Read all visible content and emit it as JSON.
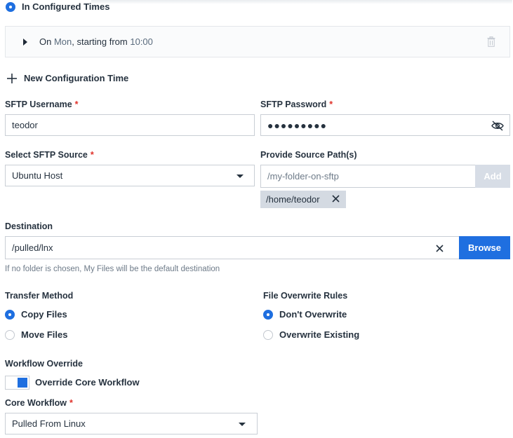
{
  "schedule": {
    "option_label": "In Configured Times",
    "entry": {
      "prefix": "On",
      "day": "Mon",
      "middle": ", starting from",
      "time": "10:00"
    },
    "new_config_label": "New Configuration Time"
  },
  "sftp": {
    "username_label": "SFTP Username",
    "username_value": "teodor",
    "password_label": "SFTP Password",
    "password_mask": "●●●●●●●●●",
    "source_label": "Select SFTP Source",
    "source_value": "Ubuntu Host",
    "path_label": "Provide Source Path(s)",
    "path_placeholder": "/my-folder-on-sftp",
    "add_label": "Add",
    "paths": [
      "/home/teodor"
    ]
  },
  "destination": {
    "label": "Destination",
    "value": "/pulled/lnx",
    "browse_label": "Browse",
    "hint": "If no folder is chosen, My Files will be the default destination"
  },
  "transfer": {
    "label": "Transfer Method",
    "options": [
      {
        "label": "Copy Files",
        "checked": true
      },
      {
        "label": "Move Files",
        "checked": false
      }
    ]
  },
  "overwrite": {
    "label": "File Overwrite Rules",
    "options": [
      {
        "label": "Don't Overwrite",
        "checked": true
      },
      {
        "label": "Overwrite Existing",
        "checked": false
      }
    ]
  },
  "workflow": {
    "override_label": "Workflow Override",
    "toggle_label": "Override Core Workflow",
    "toggle_on": true,
    "core_label": "Core Workflow",
    "core_value": "Pulled From Linux"
  },
  "colors": {
    "accent": "#1f6fe0",
    "required": "#e0322a",
    "add_disabled": "#d7dde6",
    "chip": "#d4dae2"
  }
}
